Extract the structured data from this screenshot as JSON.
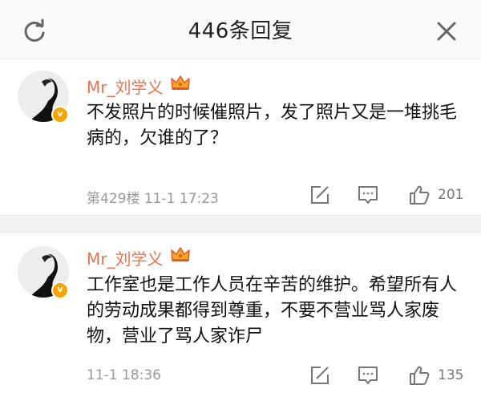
{
  "header": {
    "title": "446条回复",
    "refresh_icon": "refresh-icon",
    "close_icon": "close-icon"
  },
  "comments": [
    {
      "username": "Mr_刘学义",
      "badge_icon": "crown-icon",
      "verified_icon": "verified-icon",
      "text": "不发照片的时候催照片，发了照片又是一堆挑毛病的，欠谁的了？",
      "meta": "第429楼  11-1 17:23",
      "likes": "201"
    },
    {
      "username": "Mr_刘学义",
      "badge_icon": "crown-icon",
      "verified_icon": "verified-icon",
      "text": "工作室也是工作人员在辛苦的维护。希望所有人的劳动成果都得到尊重，不要不营业骂人家废物，营业了骂人家诈尸",
      "meta": "11-1 18:36",
      "likes": "135"
    }
  ],
  "colors": {
    "username": "#eb7350",
    "verified": "#f7a400",
    "meta": "#999999",
    "separator": "#f2f2f2"
  }
}
